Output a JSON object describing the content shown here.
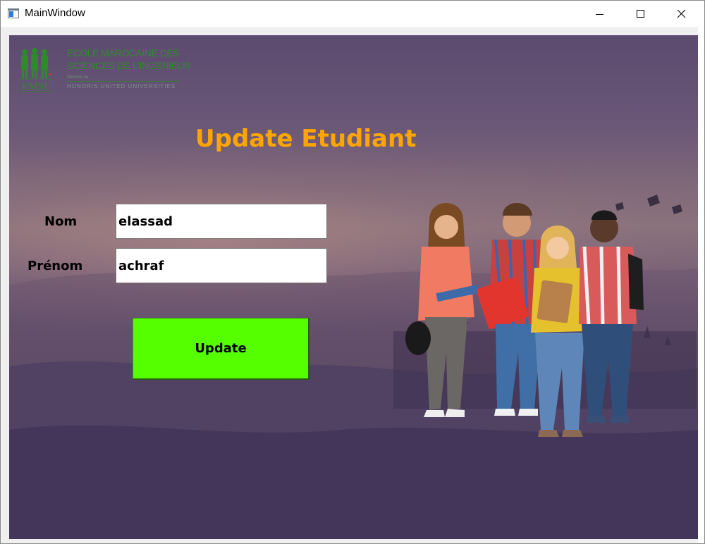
{
  "window": {
    "title": "MainWindow"
  },
  "logo": {
    "line1": "ECOLE MAROCAINE DES",
    "line2": "SCIENCES DE L'INGENIEUR",
    "line3": "Membre de",
    "line4": "HONORIS UNITED UNIVERSITIES",
    "mark_text": "EMSI"
  },
  "form": {
    "heading": "Update Etudiant",
    "nom_label": "Nom",
    "nom_value": "elassad",
    "prenom_label": "Prénom",
    "prenom_value": "achraf",
    "update_label": "Update"
  },
  "colors": {
    "heading": "#ffa500",
    "button": "#55ff00",
    "logo": "#2f8a2a"
  },
  "icons": {
    "minimize": "minimize-icon",
    "maximize": "maximize-icon",
    "close": "close-icon"
  }
}
